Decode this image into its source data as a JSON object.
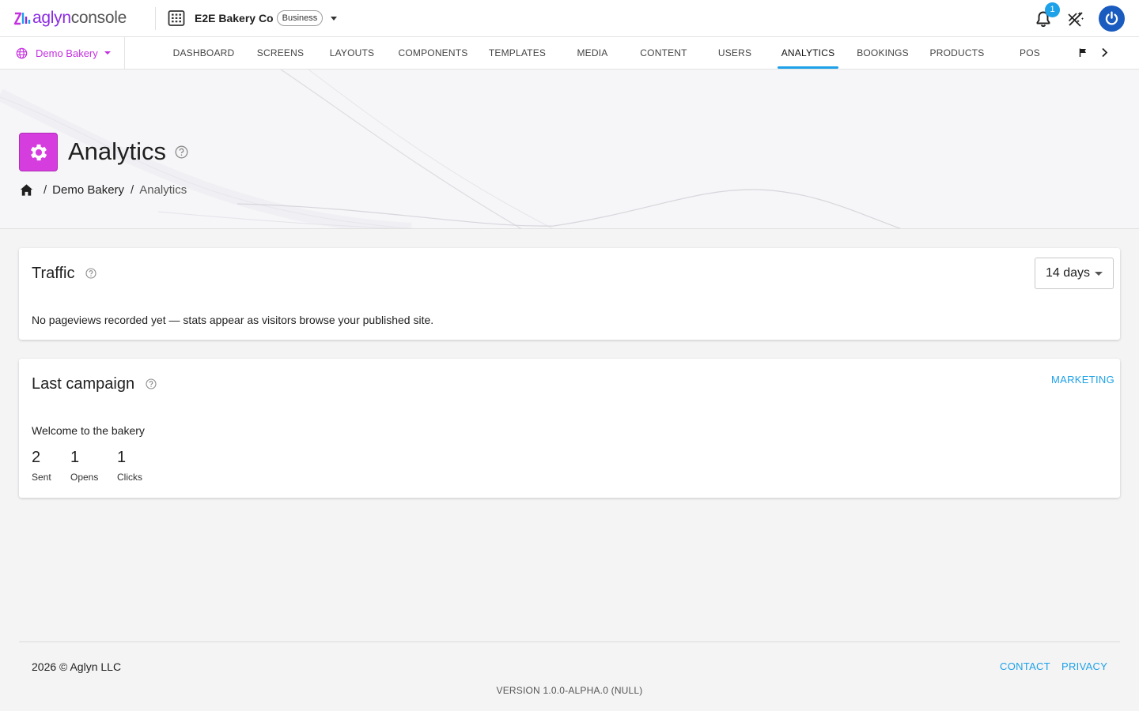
{
  "app": {
    "logo_brand": "aglyn",
    "logo_suffix": "console"
  },
  "org": {
    "name": "E2E Bakery Co",
    "plan_badge": "Business"
  },
  "header": {
    "notification_count": "1"
  },
  "site_selector": {
    "label": "Demo Bakery"
  },
  "nav": {
    "tabs": [
      {
        "label": "DASHBOARD"
      },
      {
        "label": "SCREENS"
      },
      {
        "label": "LAYOUTS"
      },
      {
        "label": "COMPONENTS"
      },
      {
        "label": "TEMPLATES"
      },
      {
        "label": "MEDIA"
      },
      {
        "label": "CONTENT"
      },
      {
        "label": "USERS"
      },
      {
        "label": "ANALYTICS",
        "active": true
      },
      {
        "label": "BOOKINGS"
      },
      {
        "label": "PRODUCTS"
      },
      {
        "label": "POS"
      }
    ]
  },
  "page": {
    "title": "Analytics",
    "breadcrumb": [
      "Demo Bakery",
      "Analytics"
    ]
  },
  "traffic": {
    "title": "Traffic",
    "range": "14 days",
    "empty_message": "No pageviews recorded yet — stats appear as visitors browse your published site."
  },
  "campaign": {
    "title": "Last campaign",
    "link": "MARKETING",
    "name": "Welcome to the bakery",
    "stats": [
      {
        "value": "2",
        "label": "Sent"
      },
      {
        "value": "1",
        "label": "Opens"
      },
      {
        "value": "1",
        "label": "Clicks"
      }
    ]
  },
  "footer": {
    "copyright": "2026 © Aglyn LLC",
    "contact": "CONTACT",
    "privacy": "PRIVACY",
    "version": "VERSION 1.0.0-ALPHA.0 (NULL)"
  },
  "colors": {
    "accent": "#1da1e8",
    "brand_magenta": "#d63ddf",
    "avatar_blue": "#1a5bbf"
  },
  "icons": {
    "logo": "aglyn-logo-icon",
    "org": "building-icon",
    "notifications": "bell-icon",
    "ai": "ai-off-icon",
    "account": "power-icon",
    "site": "globe-icon",
    "page": "gear-icon",
    "home": "home-icon",
    "help": "help-circle-icon",
    "flag": "flag-icon",
    "scroll": "chevron-right-icon"
  }
}
